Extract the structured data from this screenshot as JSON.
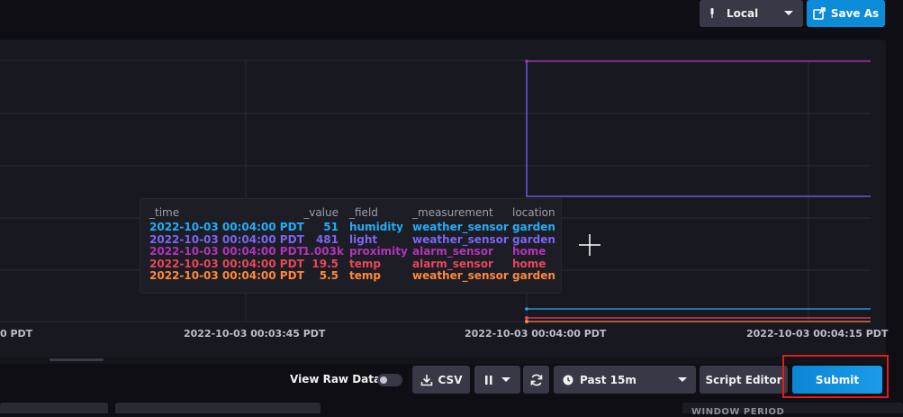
{
  "header": {
    "timezone_label": "Local",
    "save_as_label": "Save As"
  },
  "graph": {
    "x_tick_labels": [
      "0 PDT",
      "2022-10-03 00:03:45 PDT",
      "2022-10-03 00:04:00 PDT",
      "2022-10-03 00:04:15 PDT"
    ]
  },
  "tooltip": {
    "headers": {
      "time": "_time",
      "value": "_value",
      "field": "_field",
      "measurement": "_measurement",
      "location": "location"
    },
    "rows": [
      {
        "time": "2022-10-03 00:04:00 PDT",
        "value": "51",
        "field": "humidity",
        "measurement": "weather_sensor",
        "location": "garden",
        "color": "#22adf6"
      },
      {
        "time": "2022-10-03 00:04:00 PDT",
        "value": "481",
        "field": "light",
        "measurement": "weather_sensor",
        "location": "garden",
        "color": "#7a65f2"
      },
      {
        "time": "2022-10-03 00:04:00 PDT",
        "value": "1.003k",
        "field": "proximity",
        "measurement": "alarm_sensor",
        "location": "home",
        "color": "#b134b8"
      },
      {
        "time": "2022-10-03 00:04:00 PDT",
        "value": "19.5",
        "field": "temp",
        "measurement": "alarm_sensor",
        "location": "home",
        "color": "#e8465a"
      },
      {
        "time": "2022-10-03 00:04:00 PDT",
        "value": "5.5",
        "field": "temp",
        "measurement": "weather_sensor",
        "location": "garden",
        "color": "#ff8838"
      }
    ]
  },
  "toolbar": {
    "view_raw_label": "View Raw Data",
    "csv_label": "CSV",
    "time_range_label": "Past 15m",
    "script_editor_label": "Script Editor",
    "submit_label": "Submit"
  },
  "bottom_tabs": {
    "partial_label": "WINDOW PERIOD"
  },
  "colors": {
    "accent_blue": "#0c8bd9",
    "highlight_red": "#e01b1b"
  }
}
